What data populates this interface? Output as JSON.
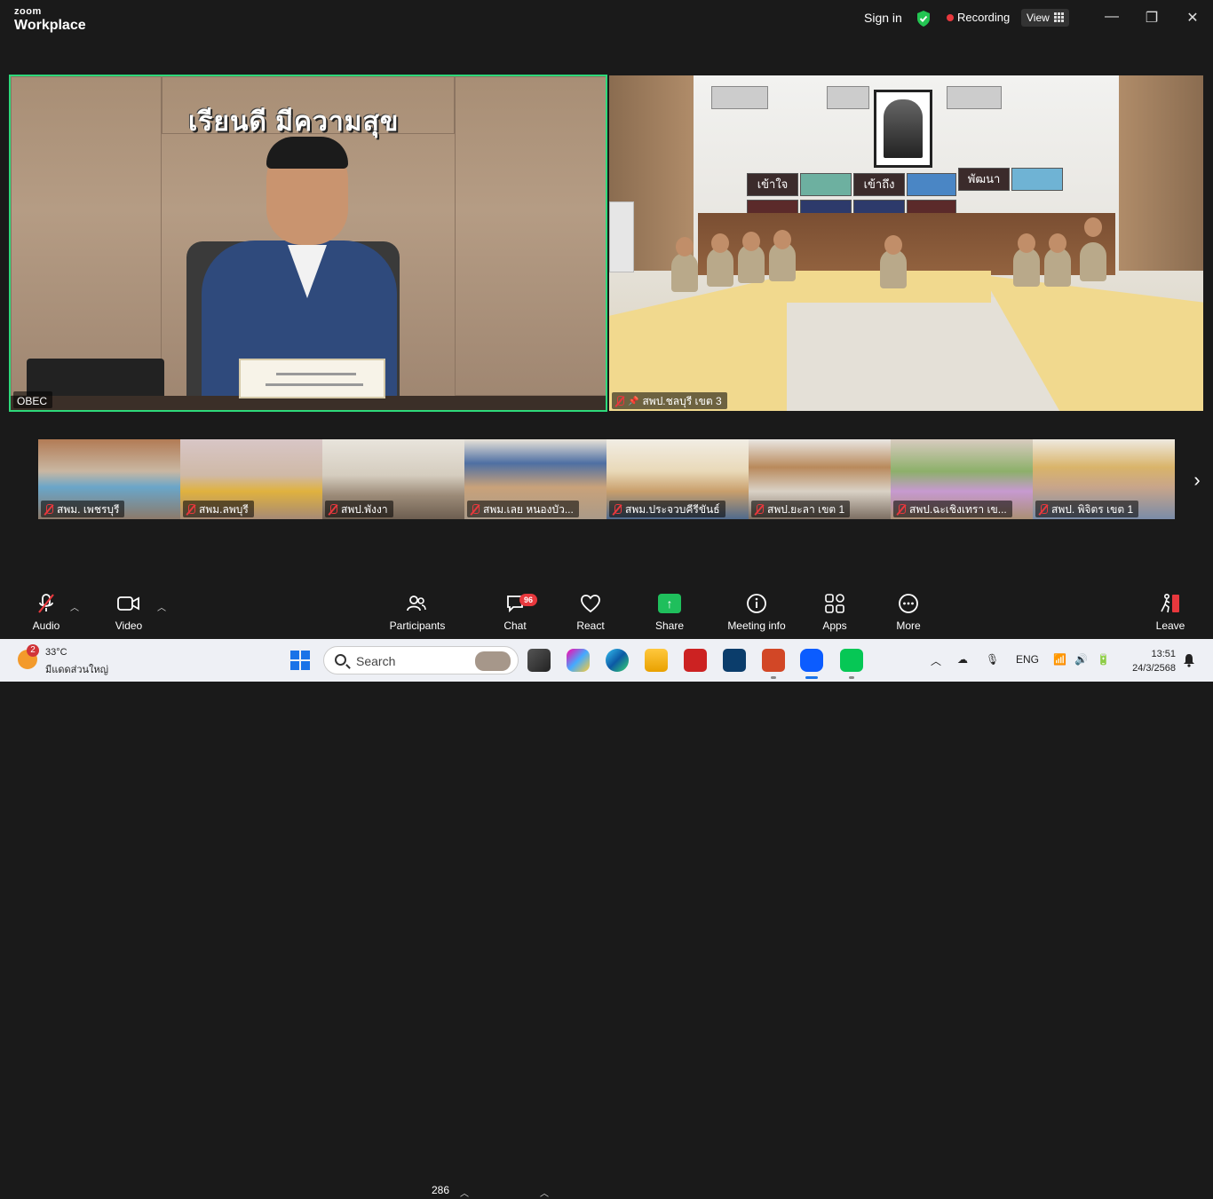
{
  "titlebar": {
    "logo_line1": "zoom",
    "logo_line2": "Workplace",
    "sign_in": "Sign in",
    "recording": "Recording",
    "view": "View",
    "minimize": "—",
    "restore": "❐",
    "close": "✕"
  },
  "main_tiles": [
    {
      "label": "OBEC",
      "banner": "เรียนดี มีความสุข"
    },
    {
      "label": "สพป.ชลบุรี เขต 3",
      "posters": [
        "เข้าใจ",
        "เข้าถึง",
        "พัฒนา"
      ]
    }
  ],
  "filmstrip": [
    {
      "label": "สพม. เพชรบุรี"
    },
    {
      "label": "สพม.ลพบุรี"
    },
    {
      "label": "สพป.พังงา"
    },
    {
      "label": "สพม.เลย หนองบัว..."
    },
    {
      "label": "สพม.ประจวบคีรีขันธ์"
    },
    {
      "label": "สพป.ยะลา เขต 1"
    },
    {
      "label": "สพป.ฉะเชิงเทรา เข..."
    },
    {
      "label": "สพป. พิจิตร เขต 1"
    }
  ],
  "toolbar": {
    "audio": "Audio",
    "video": "Video",
    "participants": "Participants",
    "participants_count": "286",
    "chat": "Chat",
    "chat_badge": "96",
    "react": "React",
    "share": "Share",
    "meeting_info": "Meeting info",
    "apps": "Apps",
    "more": "More",
    "leave": "Leave"
  },
  "taskbar": {
    "weather_badge": "2",
    "temperature": "33°C",
    "weather_desc": "มีแดดส่วนใหญ่",
    "search_placeholder": "Search",
    "language": "ENG",
    "time": "13:51",
    "date": "24/3/2568"
  },
  "colors": {
    "active_speaker_border": "#2ed97a",
    "recording_dot": "#e8383d",
    "share_green": "#1fbf5c",
    "leave_red": "#e8383d"
  }
}
